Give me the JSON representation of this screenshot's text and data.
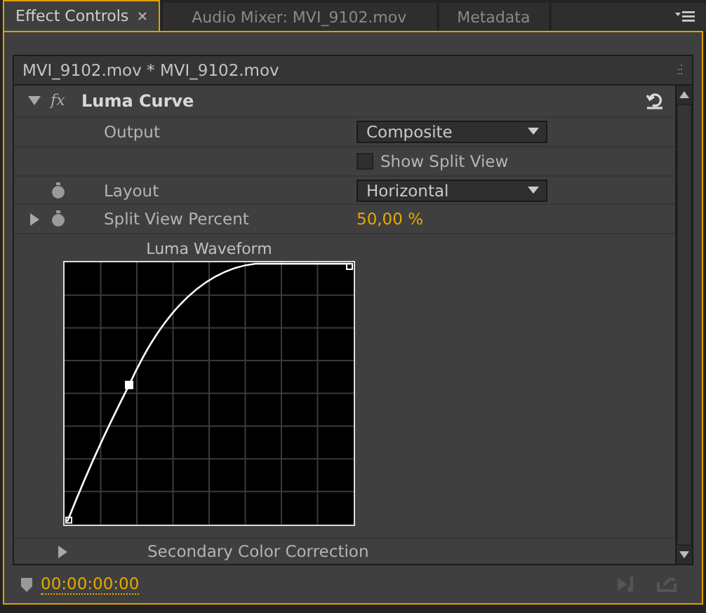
{
  "tabs": [
    {
      "label": "Effect Controls",
      "selected": true
    },
    {
      "label": "Audio Mixer: MVI_9102.mov",
      "selected": false
    },
    {
      "label": "Metadata",
      "selected": false
    }
  ],
  "clip_header": "MVI_9102.mov * MVI_9102.mov",
  "effect": {
    "fx_label": "fx",
    "name": "Luma Curve",
    "expanded": true,
    "properties": [
      {
        "kind": "dropdown",
        "label": "Output",
        "value": "Composite",
        "animatable": false
      },
      {
        "kind": "checkbox",
        "label": "Show Split View",
        "checked": false
      },
      {
        "kind": "dropdown",
        "label": "Layout",
        "value": "Horizontal",
        "animatable": true
      },
      {
        "kind": "value",
        "label": "Split View Percent",
        "value": "50,00 %",
        "animatable": true,
        "expanded": false
      }
    ],
    "graph": {
      "title": "Luma Waveform"
    }
  },
  "next_effect": {
    "name": "Secondary Color Correction",
    "expanded": false
  },
  "timecode": "00:00:00:00"
}
